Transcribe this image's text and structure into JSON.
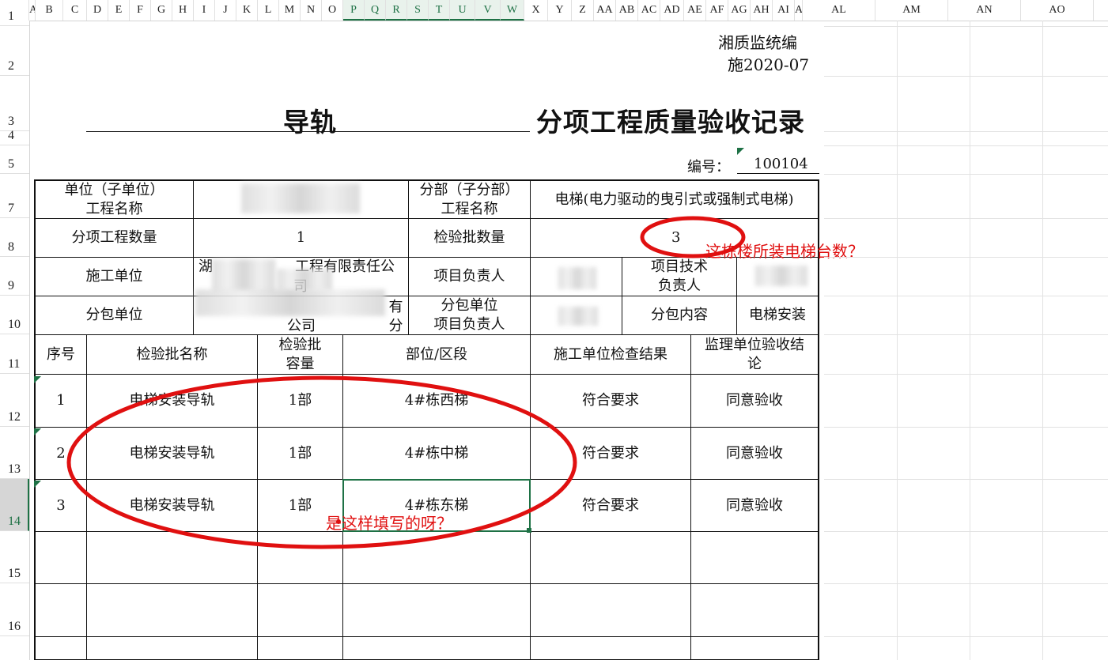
{
  "columns": [
    "A",
    "B",
    "C",
    "D",
    "E",
    "F",
    "G",
    "H",
    "I",
    "J",
    "K",
    "L",
    "M",
    "N",
    "O",
    "P",
    "Q",
    "R",
    "S",
    "T",
    "U",
    "V",
    "W",
    "X",
    "Y",
    "Z",
    "AA",
    "AB",
    "AC",
    "AD",
    "AE",
    "AF",
    "AG",
    "AH",
    "AI",
    "AJ",
    "AL",
    "AM",
    "AN",
    "AO"
  ],
  "rows": [
    "1",
    "2",
    "3",
    "4",
    "5",
    "7",
    "8",
    "9",
    "10",
    "11",
    "12",
    "13",
    "14",
    "15",
    "16"
  ],
  "header": {
    "doc_code_line1": "湘质监统编",
    "doc_code_line2": "施2020-07",
    "title_left": "导轨",
    "title_right": "分项工程质量验收记录",
    "number_label": "编号：",
    "number_value": "100104"
  },
  "info": {
    "unit_label": "单位（子单位）\n工程名称",
    "unit_value": "",
    "division_label": "分部（子分部）\n工程名称",
    "division_value": "电梯(电力驱动的曳引式或强制式电梯)",
    "item_count_label": "分项工程数量",
    "item_count_value": "1",
    "batch_count_label": "检验批数量",
    "batch_count_value": "3",
    "contractor_label": "施工单位",
    "contractor_value_a": "湖",
    "contractor_value_b": "工程有限责任公",
    "contractor_value_c": "司",
    "pm_label": "项目负责人",
    "tech_lead_label": "项目技术\n负责人",
    "sub_label": "分包单位",
    "sub_value_a": "有分",
    "sub_value_b": "公司",
    "sub_pm_label": "分包单位\n项目负责人",
    "sub_content_label": "分包内容",
    "sub_content_value": "电梯安装"
  },
  "table": {
    "headers": [
      "序号",
      "检验批名称",
      "检验批\n容量",
      "部位/区段",
      "施工单位检查结果",
      "监理单位验收结\n论"
    ],
    "rows": [
      [
        "1",
        "电梯安装导轨",
        "1部",
        "4#栋西梯",
        "符合要求",
        "同意验收"
      ],
      [
        "2",
        "电梯安装导轨",
        "1部",
        "4#栋中梯",
        "符合要求",
        "同意验收"
      ],
      [
        "3",
        "电梯安装导轨",
        "1部",
        "4#栋东梯",
        "符合要求",
        "同意验收"
      ]
    ]
  },
  "annotations": {
    "elevator_count_question": "这栋楼所装电梯台数？",
    "fill_question": "是这样填写的呀？",
    "color": "#e01010"
  }
}
